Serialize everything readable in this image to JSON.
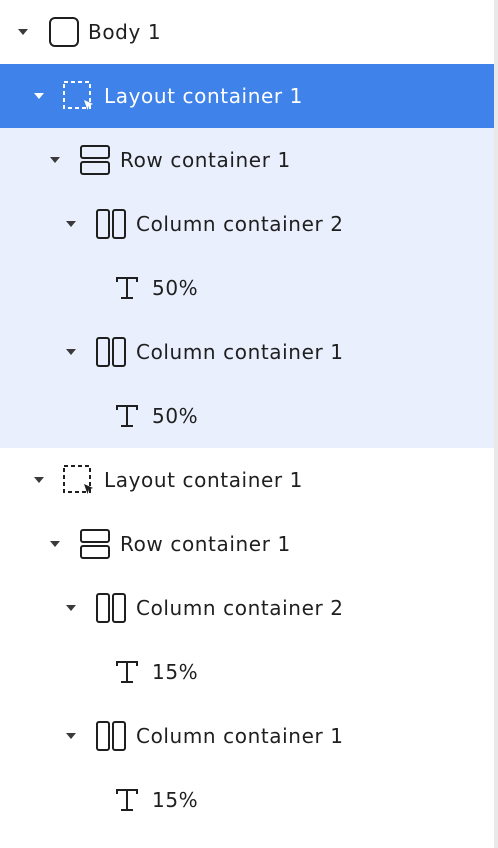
{
  "tree": {
    "body": {
      "label": "Body 1",
      "icon": "box-icon"
    },
    "selected_layout": {
      "label": "Layout container 1",
      "icon": "dashed-selection-cursor-icon",
      "row": {
        "label": "Row container 1",
        "icon": "row-container-icon",
        "col_a": {
          "label": "Column container 2",
          "icon": "column-container-icon",
          "text": {
            "label": "50%",
            "icon": "text-icon"
          }
        },
        "col_b": {
          "label": "Column container 1",
          "icon": "column-container-icon",
          "text": {
            "label": "50%",
            "icon": "text-icon"
          }
        }
      }
    },
    "second_layout": {
      "label": "Layout container 1",
      "icon": "dashed-selection-cursor-icon",
      "row": {
        "label": "Row container 1",
        "icon": "row-container-icon",
        "col_a": {
          "label": "Column container 2",
          "icon": "column-container-icon",
          "text": {
            "label": "15%",
            "icon": "text-icon"
          }
        },
        "col_b": {
          "label": "Column container 1",
          "icon": "column-container-icon",
          "text": {
            "label": "15%",
            "icon": "text-icon"
          }
        }
      }
    }
  },
  "colors": {
    "selected_strong": "#3f82ea",
    "selected_soft": "#e9effd",
    "text": "#1f1f1f"
  }
}
